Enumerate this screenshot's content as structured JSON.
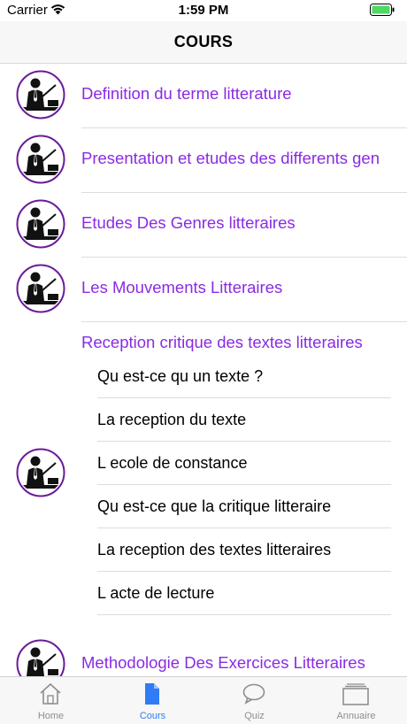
{
  "status_bar": {
    "carrier": "Carrier",
    "time": "1:59 PM"
  },
  "nav": {
    "title": "COURS"
  },
  "courses": [
    {
      "title": "Definition du terme litterature"
    },
    {
      "title": "Presentation et etudes des differents gen"
    },
    {
      "title": "Etudes Des Genres litteraires"
    },
    {
      "title": "Les Mouvements Litteraires"
    }
  ],
  "group": {
    "title": "Reception critique des textes litteraires",
    "items": [
      "Qu est-ce qu un texte ?",
      "La reception du texte",
      "L ecole de constance",
      "Qu est-ce que la critique litteraire",
      "La reception des textes litteraires",
      "L acte de lecture"
    ]
  },
  "last_course": {
    "title": "Methodologie Des Exercices Litteraires"
  },
  "tabs": [
    {
      "label": "Home",
      "icon": "home-icon"
    },
    {
      "label": "Cours",
      "icon": "document-icon",
      "active": true
    },
    {
      "label": "Quiz",
      "icon": "chat-bubble-icon"
    },
    {
      "label": "Annuaire",
      "icon": "stack-icon"
    }
  ],
  "colors": {
    "accent": "#8a2be2",
    "tab_active": "#2f7cf6",
    "avatar_ring": "#6a1b9a",
    "battery": "#4cd964"
  }
}
